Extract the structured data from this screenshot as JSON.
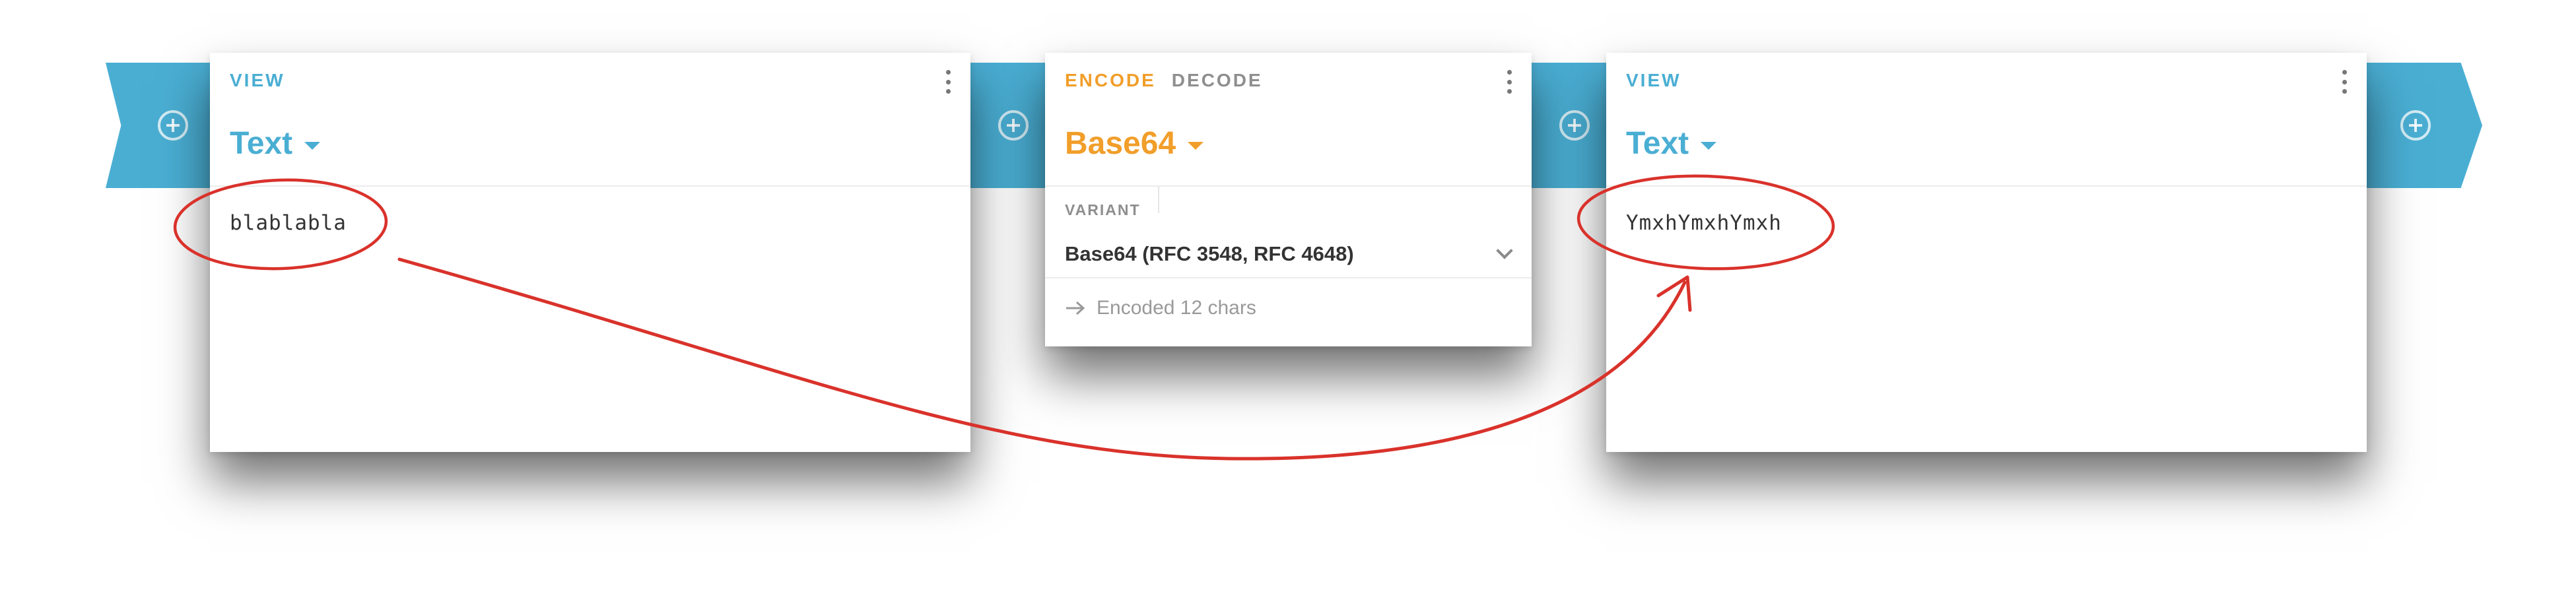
{
  "pipeline": {
    "add_button_label": "Add"
  },
  "view_left": {
    "tab": "VIEW",
    "format": "Text",
    "content": "blablabla"
  },
  "codec": {
    "tabs": [
      "ENCODE",
      "DECODE"
    ],
    "format": "Base64",
    "variant_label": "VARIANT",
    "variant_value": "Base64 (RFC 3548, RFC 4648)",
    "status": "Encoded 12 chars"
  },
  "view_right": {
    "tab": "VIEW",
    "format": "Text",
    "content": "YmxhYmxhYmxh"
  },
  "colors": {
    "ribbon": "#4aaed3",
    "view_accent": "#4aaed3",
    "codec_accent": "#f19e2a",
    "annotation": "#d9322b"
  },
  "icons": [
    "add-circle-icon",
    "more-vert-icon",
    "dropdown-caret-icon",
    "chevron-down-icon",
    "arrow-right-icon"
  ]
}
